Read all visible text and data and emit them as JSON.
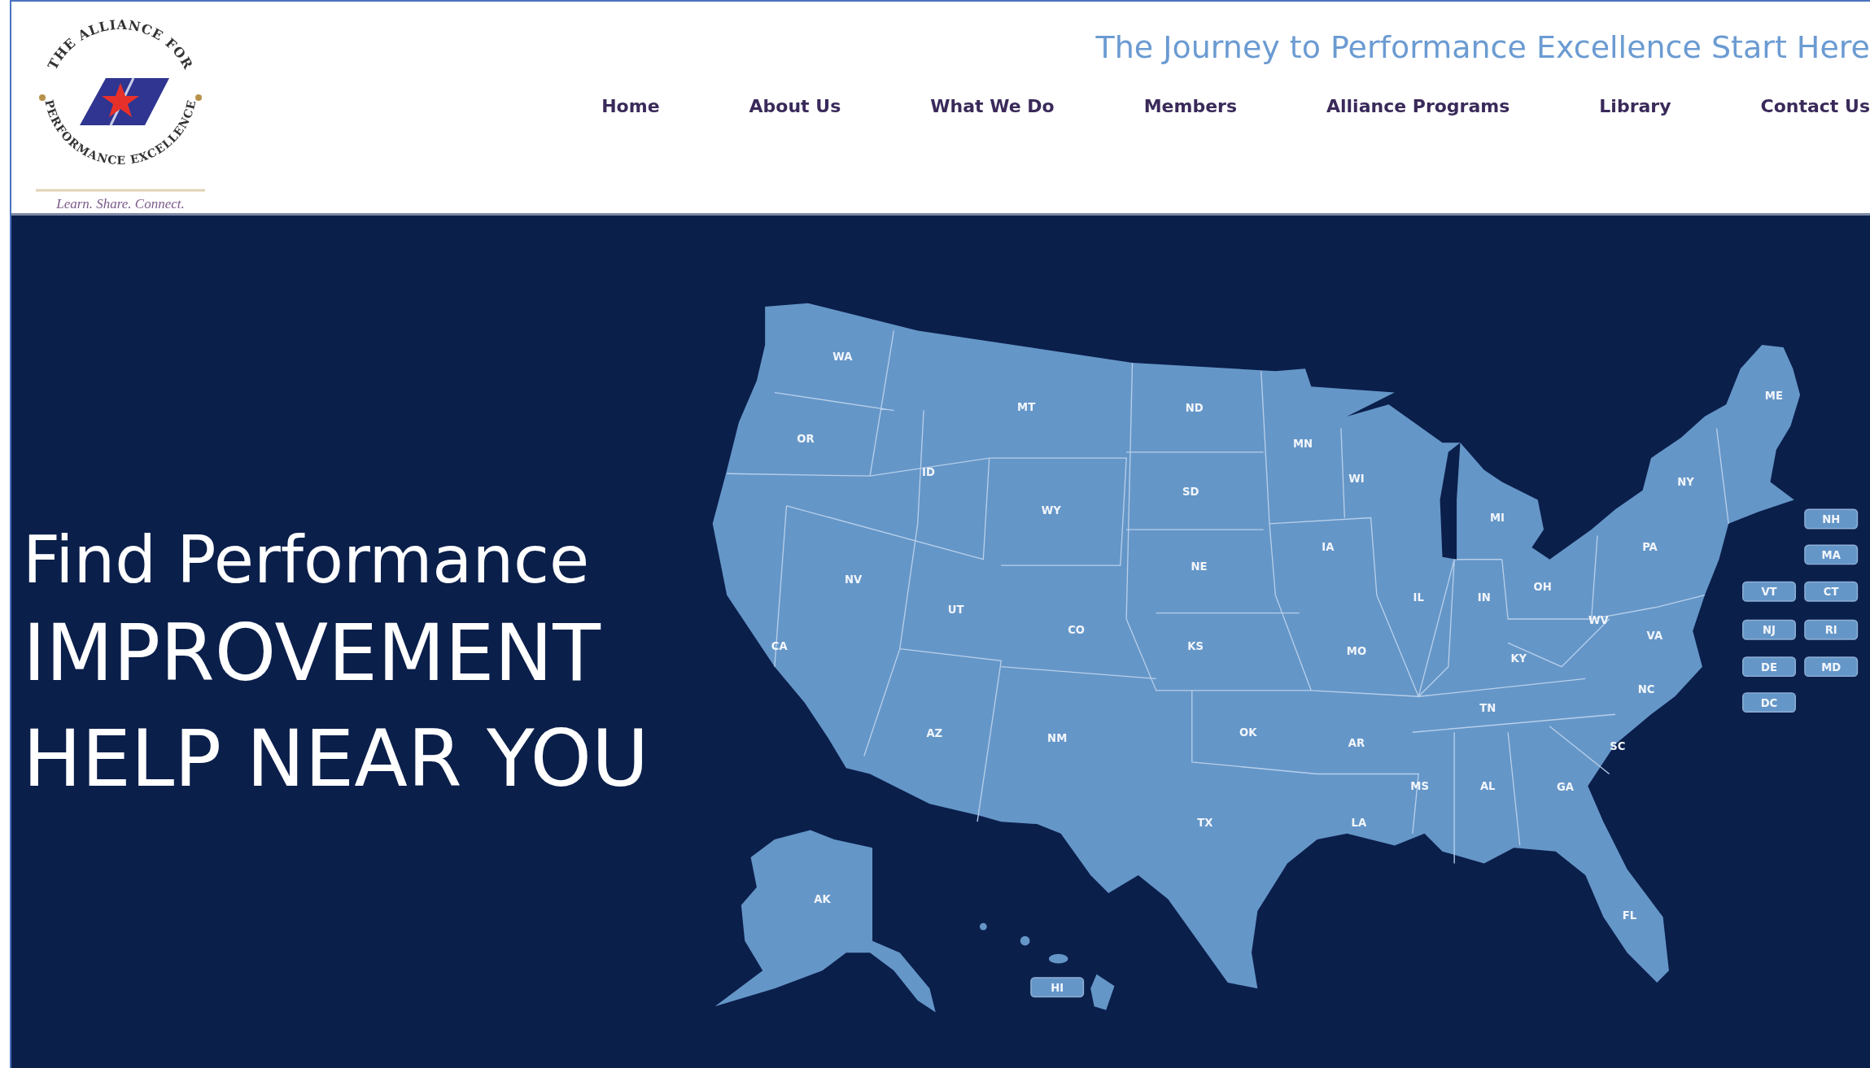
{
  "logo": {
    "arc_top": "THE ALLIANCE FOR",
    "arc_bottom": "PERFORMANCE EXCELLENCE",
    "tagline": "Learn. Share. Connect."
  },
  "tagline": "The Journey to Performance Excellence Start Here",
  "nav": [
    "Home",
    "About Us",
    "What We Do",
    "Members",
    "Alliance Programs",
    "Library",
    "Contact Us"
  ],
  "hero": {
    "line_1": "Find Performance",
    "line_2": "IMPROVEMENT",
    "line_3": "HELP NEAR YOU"
  },
  "map": {
    "states": [
      {
        "abbr": "WA",
        "kind": "label"
      },
      {
        "abbr": "ME",
        "kind": "label"
      },
      {
        "abbr": "MT",
        "kind": "label"
      },
      {
        "abbr": "ND",
        "kind": "label"
      },
      {
        "abbr": "OR",
        "kind": "label"
      },
      {
        "abbr": "MN",
        "kind": "label"
      },
      {
        "abbr": "ID",
        "kind": "label"
      },
      {
        "abbr": "WI",
        "kind": "label"
      },
      {
        "abbr": "NY",
        "kind": "label"
      },
      {
        "abbr": "SD",
        "kind": "label"
      },
      {
        "abbr": "WY",
        "kind": "label"
      },
      {
        "abbr": "MI",
        "kind": "label"
      },
      {
        "abbr": "IA",
        "kind": "label"
      },
      {
        "abbr": "PA",
        "kind": "label"
      },
      {
        "abbr": "NE",
        "kind": "label"
      },
      {
        "abbr": "NV",
        "kind": "label"
      },
      {
        "abbr": "OH",
        "kind": "label"
      },
      {
        "abbr": "IL",
        "kind": "label"
      },
      {
        "abbr": "IN",
        "kind": "label"
      },
      {
        "abbr": "UT",
        "kind": "label"
      },
      {
        "abbr": "WV",
        "kind": "label"
      },
      {
        "abbr": "CO",
        "kind": "label"
      },
      {
        "abbr": "VA",
        "kind": "label"
      },
      {
        "abbr": "CA",
        "kind": "label"
      },
      {
        "abbr": "KS",
        "kind": "label"
      },
      {
        "abbr": "MO",
        "kind": "label"
      },
      {
        "abbr": "KY",
        "kind": "label"
      },
      {
        "abbr": "NC",
        "kind": "label"
      },
      {
        "abbr": "TN",
        "kind": "label"
      },
      {
        "abbr": "AZ",
        "kind": "label"
      },
      {
        "abbr": "NM",
        "kind": "label"
      },
      {
        "abbr": "OK",
        "kind": "label"
      },
      {
        "abbr": "AR",
        "kind": "label"
      },
      {
        "abbr": "SC",
        "kind": "label"
      },
      {
        "abbr": "MS",
        "kind": "label"
      },
      {
        "abbr": "AL",
        "kind": "label"
      },
      {
        "abbr": "GA",
        "kind": "label"
      },
      {
        "abbr": "TX",
        "kind": "label"
      },
      {
        "abbr": "LA",
        "kind": "label"
      },
      {
        "abbr": "AK",
        "kind": "label"
      },
      {
        "abbr": "FL",
        "kind": "label"
      }
    ],
    "buttons": [
      {
        "abbr": "NH",
        "kind": "button"
      },
      {
        "abbr": "MA",
        "kind": "button"
      },
      {
        "abbr": "VT",
        "kind": "button"
      },
      {
        "abbr": "CT",
        "kind": "button"
      },
      {
        "abbr": "NJ",
        "kind": "button"
      },
      {
        "abbr": "RI",
        "kind": "button"
      },
      {
        "abbr": "DE",
        "kind": "button"
      },
      {
        "abbr": "MD",
        "kind": "button"
      },
      {
        "abbr": "DC",
        "kind": "button"
      },
      {
        "abbr": "HI",
        "kind": "button"
      }
    ]
  }
}
